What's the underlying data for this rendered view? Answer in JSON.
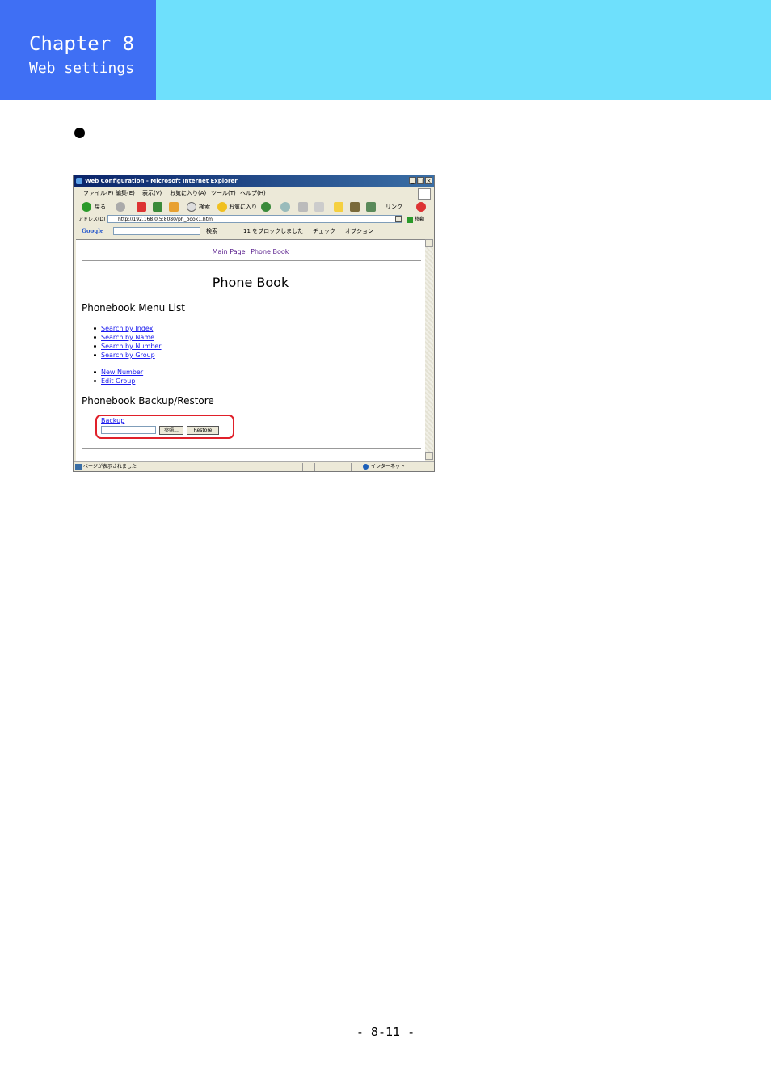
{
  "header": {
    "chapter": "Chapter 8",
    "subtitle": "Web settings"
  },
  "browser": {
    "title": "Web Configuration - Microsoft Internet Explorer",
    "menu": [
      "ファイル(F)",
      "編集(E)",
      "表示(V)",
      "お気に入り(A)",
      "ツール(T)",
      "ヘルプ(H)"
    ],
    "toolbar": {
      "back": "戻る",
      "search": "検索",
      "favorites": "お気に入り",
      "links": "リンク"
    },
    "address_label": "アドレス(D)",
    "address": "http://192.168.0.5:8080/ph_book1.html",
    "go": "移動",
    "google_bar": {
      "logo": "Google",
      "search": "検索",
      "blocked": "11 をブロックしました",
      "check": "チェック",
      "options": "オプション"
    },
    "status": "ページが表示されました",
    "zone": "インターネット"
  },
  "page": {
    "nav": [
      "Main Page",
      "Phone Book"
    ],
    "title": "Phone Book",
    "menu_heading": "Phonebook Menu List",
    "search_links": [
      "Search by Index",
      "Search by Name",
      "Search by Number",
      "Search by Group"
    ],
    "edit_links": [
      "New Number",
      "Edit Group"
    ],
    "backup_heading": "Phonebook Backup/Restore",
    "backup_link": "Backup",
    "browse_button": "参照...",
    "restore_button": "Restore"
  },
  "footer": {
    "page_number": "- 8-11 -"
  }
}
